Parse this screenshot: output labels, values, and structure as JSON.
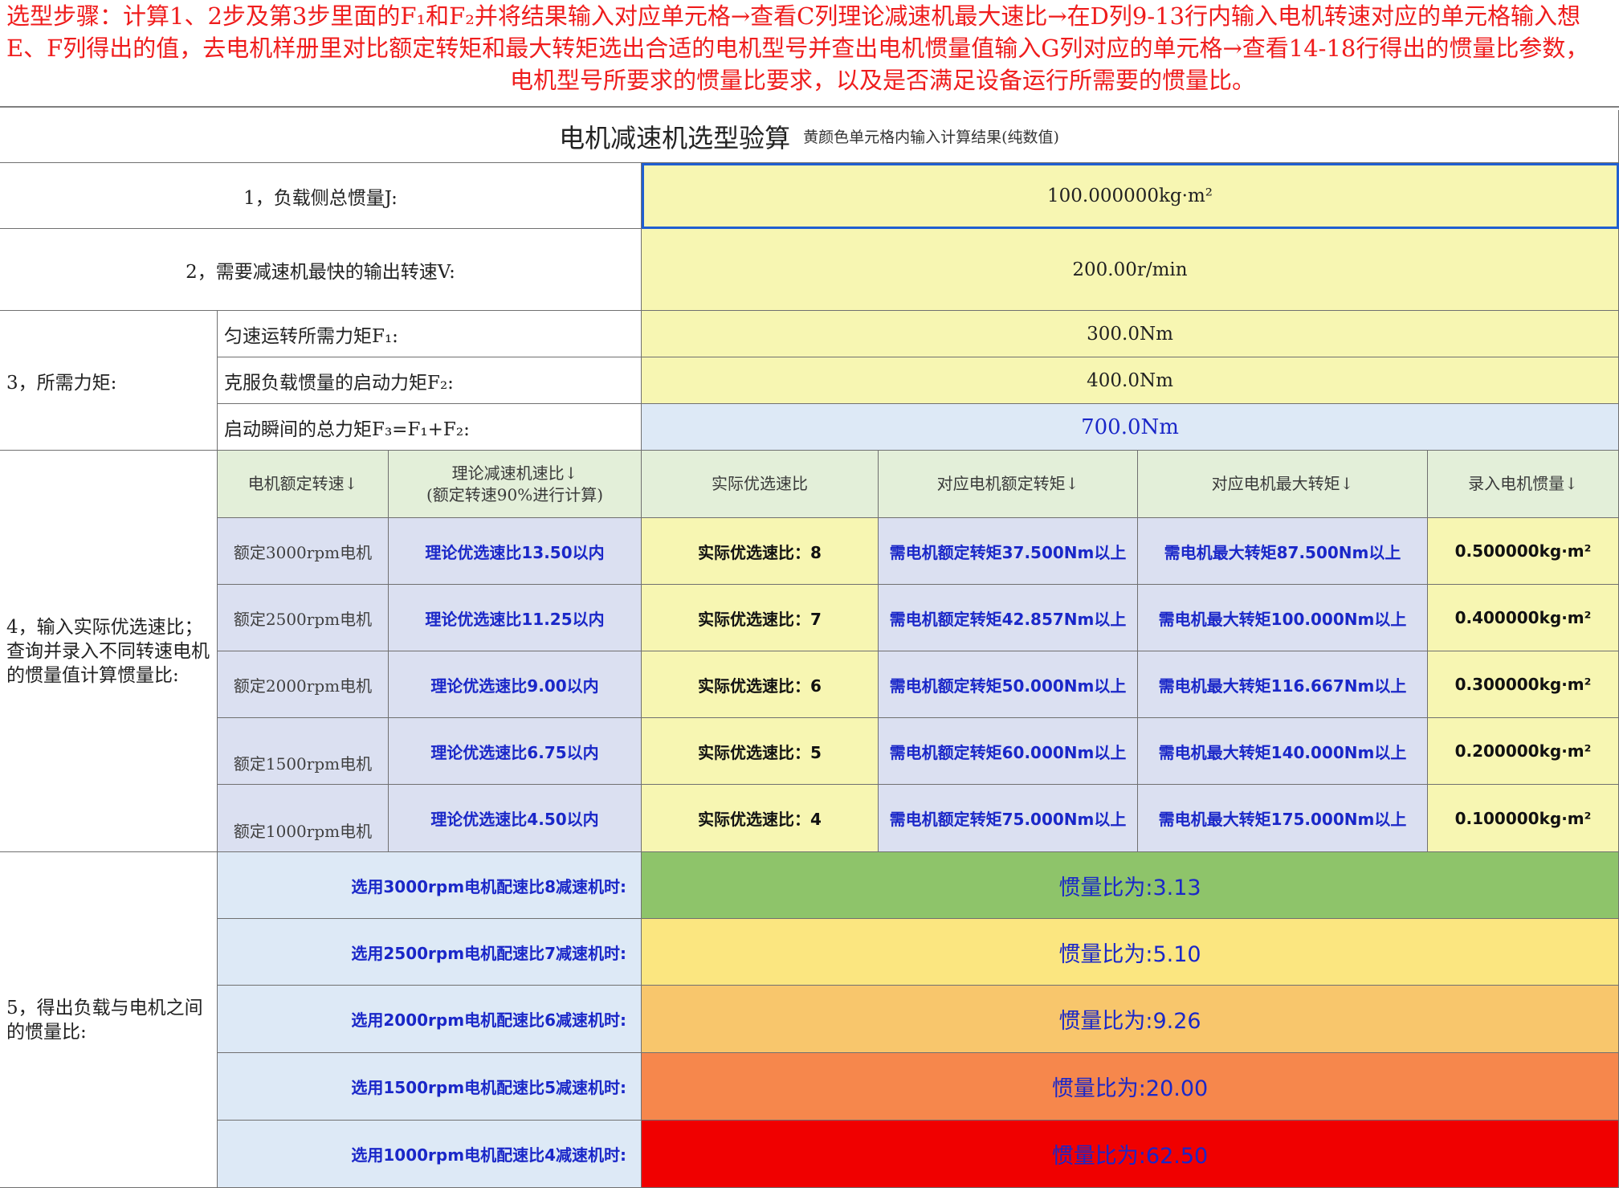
{
  "instruction": {
    "line1": "选型步骤：计算1、2步及第3步里面的F₁和F₂并将结果输入对应单元格→查看C列理论减速机最大速比→在D列9-13行内输入电机转速对应的单元格输入想",
    "line2": "E、F列得出的值，去电机样册里对比额定转矩和最大转矩选出合适的电机型号并查出电机惯量值输入G列对应的单元格→查看14-18行得出的惯量比参数，",
    "line3": "电机型号所要求的惯量比要求，以及是否满足设备运行所需要的惯量比。"
  },
  "sheet": {
    "title": "电机减速机选型验算",
    "subtitle": "黄颜色单元格内输入计算结果(纯数值)",
    "step1": {
      "label": "1，负载侧总惯量J:",
      "value": "100.000000kg·m²"
    },
    "step2": {
      "label": "2，需要减速机最快的输出转速V:",
      "value": "200.00r/min"
    },
    "step3": {
      "label": "3，所需力矩:",
      "rows": [
        {
          "label": "匀速运转所需力矩F₁:",
          "value": "300.0Nm"
        },
        {
          "label": "克服负载惯量的启动力矩F₂:",
          "value": "400.0Nm"
        },
        {
          "label": "启动瞬间的总力矩F₃=F₁+F₂:",
          "value": "700.0Nm"
        }
      ]
    },
    "step4": {
      "label": "4，输入实际优选速比；查询并录入不同转速电机的惯量值计算惯量比:",
      "headers": {
        "speed": "电机额定转速↓",
        "theory_line1": "理论减速机速比↓",
        "theory_line2": "(额定转速90%进行计算)",
        "actual": "实际优选速比",
        "rated_torque": "对应电机额定转矩↓",
        "max_torque": "对应电机最大转矩↓",
        "inertia": "录入电机惯量↓"
      },
      "rows": [
        {
          "speed": "额定3000rpm电机",
          "theory": "理论优选速比13.50以内",
          "actual": "实际优选速比：8",
          "rated": "需电机额定转矩37.500Nm以上",
          "max": "需电机最大转矩87.500Nm以上",
          "inertia": "0.500000kg·m²"
        },
        {
          "speed": "额定2500rpm电机",
          "theory": "理论优选速比11.25以内",
          "actual": "实际优选速比：7",
          "rated": "需电机额定转矩42.857Nm以上",
          "max": "需电机最大转矩100.000Nm以上",
          "inertia": "0.400000kg·m²"
        },
        {
          "speed": "额定2000rpm电机",
          "theory": "理论优选速比9.00以内",
          "actual": "实际优选速比：6",
          "rated": "需电机额定转矩50.000Nm以上",
          "max": "需电机最大转矩116.667Nm以上",
          "inertia": "0.300000kg·m²"
        },
        {
          "speed": "额定1500rpm电机",
          "theory": "理论优选速比6.75以内",
          "actual": "实际优选速比：5",
          "rated": "需电机额定转矩60.000Nm以上",
          "max": "需电机最大转矩140.000Nm以上",
          "inertia": "0.200000kg·m²"
        },
        {
          "speed": "额定1000rpm电机",
          "theory": "理论优选速比4.50以内",
          "actual": "实际优选速比：4",
          "rated": "需电机额定转矩75.000Nm以上",
          "max": "需电机最大转矩175.000Nm以上",
          "inertia": "0.100000kg·m²"
        }
      ]
    },
    "step5": {
      "label": "5，得出负载与电机之间的惯量比:",
      "rows": [
        {
          "label": "选用3000rpm电机配速比8减速机时:",
          "value": "惯量比为:3.13",
          "color": "#8ec46a"
        },
        {
          "label": "选用2500rpm电机配速比7减速机时:",
          "value": "惯量比为:5.10",
          "color": "#fbe680"
        },
        {
          "label": "选用2000rpm电机配速比6减速机时:",
          "value": "惯量比为:9.26",
          "color": "#f8c66c"
        },
        {
          "label": "选用1500rpm电机配速比5减速机时:",
          "value": "惯量比为:20.00",
          "color": "#f6874c"
        },
        {
          "label": "选用1000rpm电机配速比4减速机时:",
          "value": "惯量比为:62.50",
          "color": "#f00000"
        }
      ]
    }
  }
}
